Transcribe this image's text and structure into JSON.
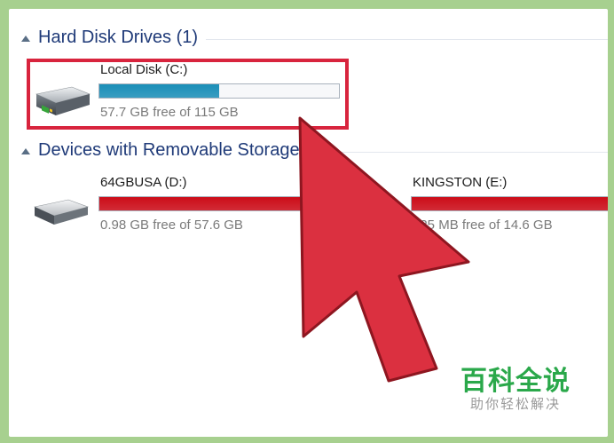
{
  "sections": {
    "hard_disk": {
      "title": "Hard Disk Drives (1)"
    },
    "removable": {
      "title": "Devices with Removable Storage (2)"
    }
  },
  "drives": {
    "c": {
      "name": "Local Disk (C:)",
      "free_text": "57.7 GB free of 115 GB",
      "used_fraction": 0.5,
      "bar_color": "#1b8fb8"
    },
    "d": {
      "name": "64GBUSA (D:)",
      "free_text": "0.98 GB free of 57.6 GB",
      "used_fraction": 0.98,
      "bar_color": "#cc0c18"
    },
    "e": {
      "name": "KINGSTON (E:)",
      "free_text": "125 MB free of 14.6 GB",
      "used_fraction": 0.99,
      "bar_color": "#cc0c18"
    }
  },
  "watermark": {
    "brand": "百科全说",
    "sub": "助你轻松解决"
  },
  "colors": {
    "background": "#a7d08f",
    "selection": "#d8243d",
    "cursor": "#db3040",
    "watermark_green": "#2aa84a"
  }
}
